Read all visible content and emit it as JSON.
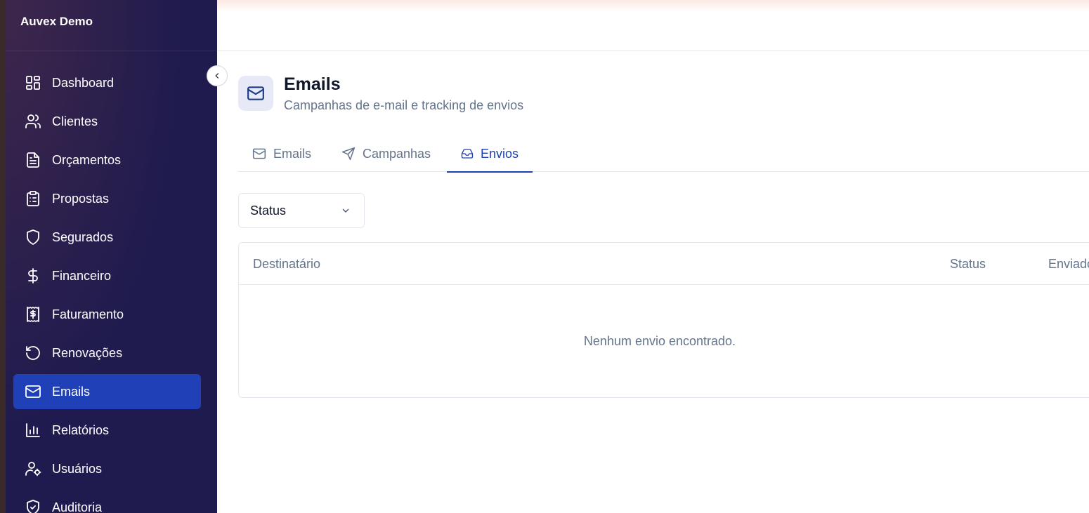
{
  "app": {
    "brand": "Auvex Demo"
  },
  "sidebar": {
    "items": [
      {
        "label": "Dashboard",
        "icon": "dashboard-icon",
        "active": false
      },
      {
        "label": "Clientes",
        "icon": "users-icon",
        "active": false
      },
      {
        "label": "Orçamentos",
        "icon": "file-text-icon",
        "active": false
      },
      {
        "label": "Propostas",
        "icon": "clipboard-list-icon",
        "active": false
      },
      {
        "label": "Segurados",
        "icon": "shield-icon",
        "active": false
      },
      {
        "label": "Financeiro",
        "icon": "dollar-icon",
        "active": false
      },
      {
        "label": "Faturamento",
        "icon": "receipt-icon",
        "active": false
      },
      {
        "label": "Renovações",
        "icon": "rotate-ccw-icon",
        "active": false
      },
      {
        "label": "Emails",
        "icon": "mail-icon",
        "active": true
      },
      {
        "label": "Relatórios",
        "icon": "bar-chart-icon",
        "active": false
      },
      {
        "label": "Usuários",
        "icon": "user-cog-icon",
        "active": false
      },
      {
        "label": "Auditoria",
        "icon": "shield-check-icon",
        "active": false
      }
    ]
  },
  "header": {
    "title": "Emails",
    "subtitle": "Campanhas de e-mail e tracking de envios"
  },
  "tabs": [
    {
      "label": "Emails",
      "icon": "mail-icon",
      "active": false
    },
    {
      "label": "Campanhas",
      "icon": "send-icon",
      "active": false
    },
    {
      "label": "Envios",
      "icon": "inbox-icon",
      "active": true
    }
  ],
  "filters": {
    "status_label": "Status"
  },
  "table": {
    "columns": [
      "Destinatário",
      "Status",
      "Enviado"
    ],
    "empty_message": "Nenhum envio encontrado."
  },
  "colors": {
    "sidebar_bg": "#1f1b4e",
    "active_nav": "#1f40b6",
    "accent": "#1e40af"
  }
}
